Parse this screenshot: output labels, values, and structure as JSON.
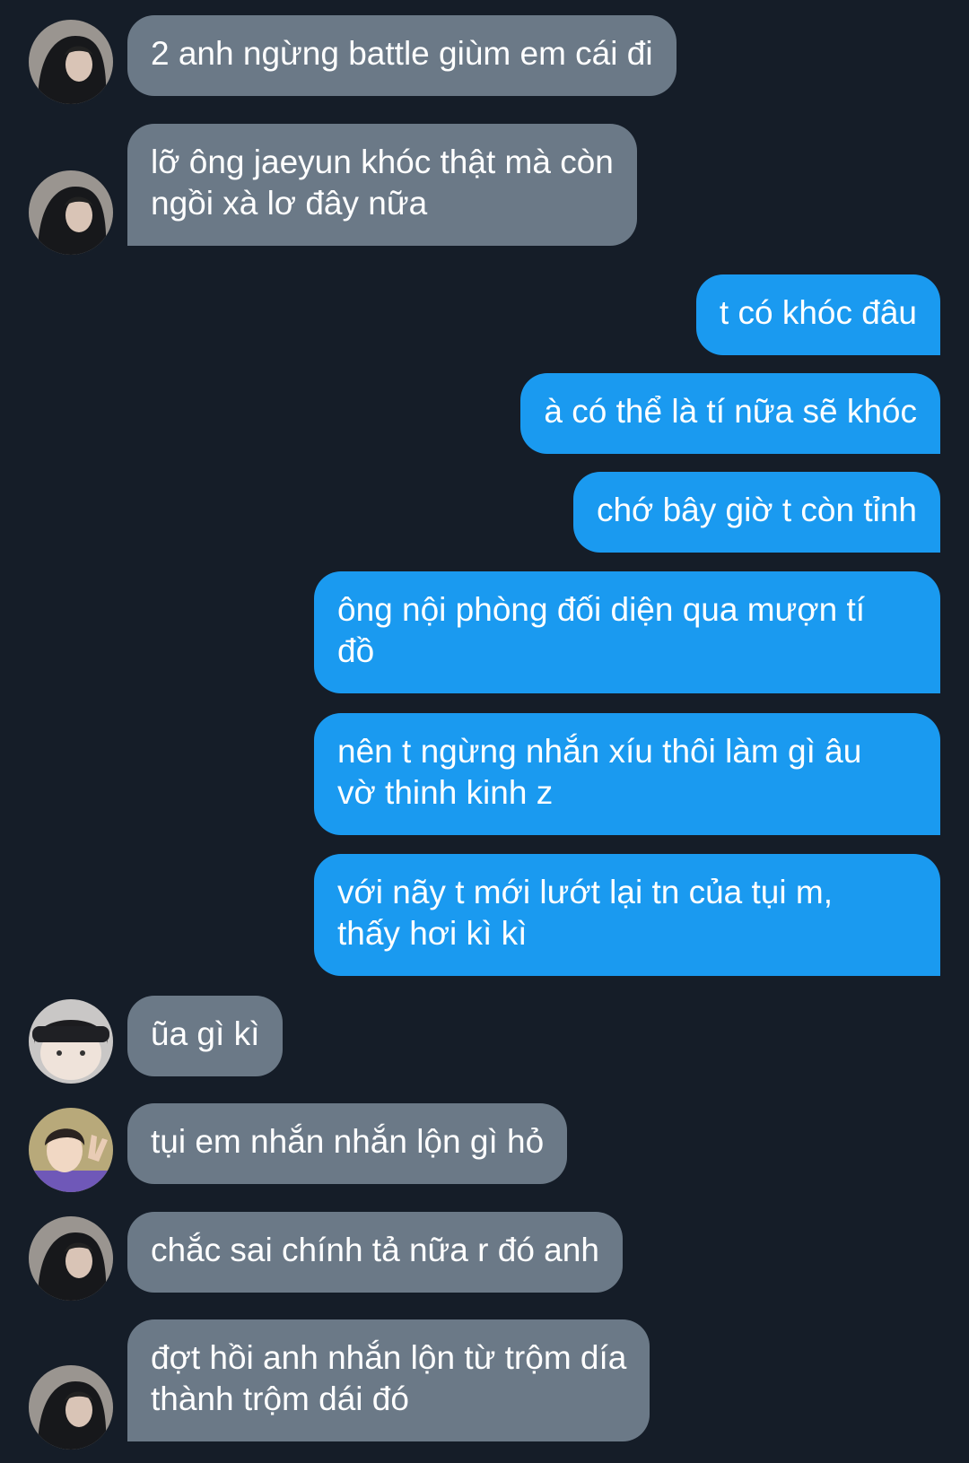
{
  "chat": {
    "messages": [
      {
        "side": "in",
        "avatar": "hood-avatar",
        "lines": [
          "2 anh ngừng battle giùm em cái đi"
        ]
      },
      {
        "side": "in",
        "avatar": "hood-avatar",
        "lines": [
          "lỡ ông jaeyun khóc thật mà còn",
          "ngồi xà lơ đây nữa"
        ]
      },
      {
        "side": "out",
        "lines": [
          "t có khóc đâu"
        ]
      },
      {
        "side": "out",
        "lines": [
          "à có thể là tí nữa sẽ khóc"
        ]
      },
      {
        "side": "out",
        "lines": [
          "chớ bây giờ t còn tỉnh"
        ]
      },
      {
        "side": "out",
        "lines": [
          "ông nội phòng đối diện qua mượn tí",
          "đồ"
        ]
      },
      {
        "side": "out",
        "lines": [
          "nên t ngừng nhắn xíu thôi làm gì âu",
          "vờ thinh kinh z"
        ]
      },
      {
        "side": "out",
        "lines": [
          "với nãy t mới lướt lại tn của tụi m,",
          "thấy hơi kì kì"
        ]
      },
      {
        "side": "in",
        "avatar": "beanie-avatar",
        "lines": [
          "ũa gì kì"
        ]
      },
      {
        "side": "in",
        "avatar": "peace-sign-avatar",
        "lines": [
          "tụi em nhắn nhắn lộn gì hỏ"
        ]
      },
      {
        "side": "in",
        "avatar": "hood-avatar",
        "lines": [
          "chắc sai chính tả nữa r đó anh"
        ]
      },
      {
        "side": "in",
        "avatar": "hood-avatar",
        "lines": [
          "đợt hồi anh nhắn lộn từ trộm día",
          "thành trộm dái đó"
        ]
      }
    ]
  },
  "colors": {
    "background": "#151d28",
    "incoming_bubble": "#6b7987",
    "outgoing_bubble": "#1a9af0",
    "text": "#ffffff"
  }
}
